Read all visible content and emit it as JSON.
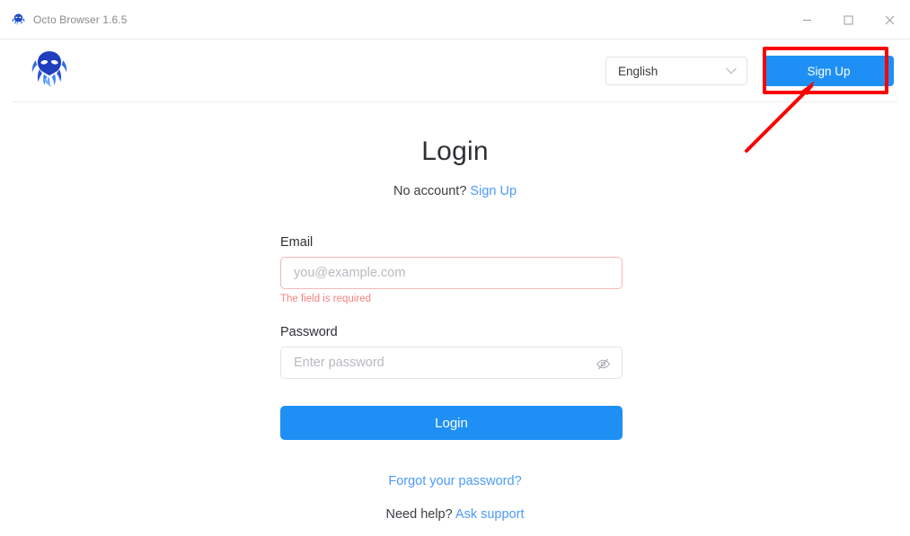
{
  "window": {
    "title": "Octo Browser 1.6.5",
    "app_icon": "octopus-icon",
    "controls": {
      "minimize": "minimize-icon",
      "maximize": "maximize-icon",
      "close": "close-icon"
    }
  },
  "header": {
    "logo": "octo-browser-logo",
    "language": {
      "selected": "English",
      "chevron": "chevron-down-icon"
    },
    "signup_label": "Sign Up"
  },
  "annotation": {
    "highlight_color": "#fb0000",
    "target": "Sign Up",
    "shapes": [
      "rectangle",
      "arrow"
    ]
  },
  "main": {
    "title": "Login",
    "subtitle_prefix": "No account?",
    "subtitle_link": "Sign Up",
    "email": {
      "label": "Email",
      "value": "",
      "placeholder": "you@example.com",
      "error": "The field is required"
    },
    "password": {
      "label": "Password",
      "value": "",
      "placeholder": "Enter password",
      "toggle_icon": "eye-off-icon"
    },
    "login_label": "Login",
    "forgot_label": "Forgot your password?",
    "support_prefix": "Need help?",
    "support_link": "Ask support"
  },
  "colors": {
    "accent": "#1e90f5",
    "link": "#4b9bf8",
    "error": "#f98080",
    "error_border": "#f7b8b8",
    "annotation": "#fb0000"
  }
}
